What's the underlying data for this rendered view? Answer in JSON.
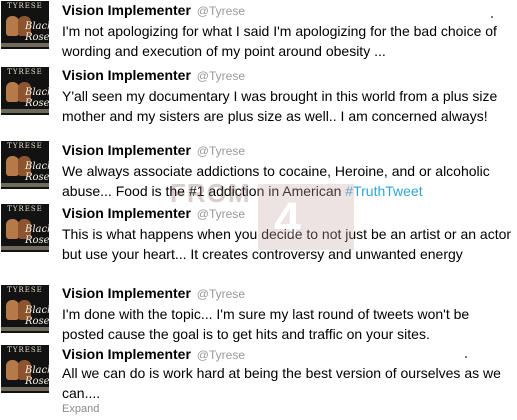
{
  "tweets": [
    {
      "name": "Vision Implementer",
      "handle": "@Tyrese",
      "text": "I'm not apologizing for what I said I'm apologizing for the bad choice of wording and execution of my point around obesity ..."
    },
    {
      "name": "Vision Implementer",
      "handle": "@Tyrese",
      "text": "Y'all seen my documentary I was brought in this world from a plus size mother and my sisters are plus size as well.. I am concerned always!"
    },
    {
      "name": "Vision Implementer",
      "handle": "@Tyrese",
      "text": "We always associate addictions to cocaine, Heroine, and or alcoholic abuse... Food is the #1 addiction in American",
      "hashtag": "#TruthTweet"
    },
    {
      "name": "Vision Implementer",
      "handle": "@Tyrese",
      "text": "This is what happens when you decide to not just be an artist or an actor but use your heart... It creates controversy and unwanted energy"
    },
    {
      "name": "Vision Implementer",
      "handle": "@Tyrese",
      "text": "I'm done with the topic... I'm sure my last round of tweets won't be posted cause the goal is to get hits and traffic on your sites."
    },
    {
      "name": "Vision Implementer",
      "handle": "@Tyrese",
      "text": "All we can do is work hard at being the best version of ourselves as we can...."
    }
  ],
  "avatar": {
    "top_text": "TYRESE",
    "script_text": "Black Rose"
  },
  "expand_label": "Expand",
  "watermark": {
    "text": "FROM"
  },
  "colors": {
    "hashtag": "#2fa4d9",
    "handle": "#9a9a9a"
  }
}
